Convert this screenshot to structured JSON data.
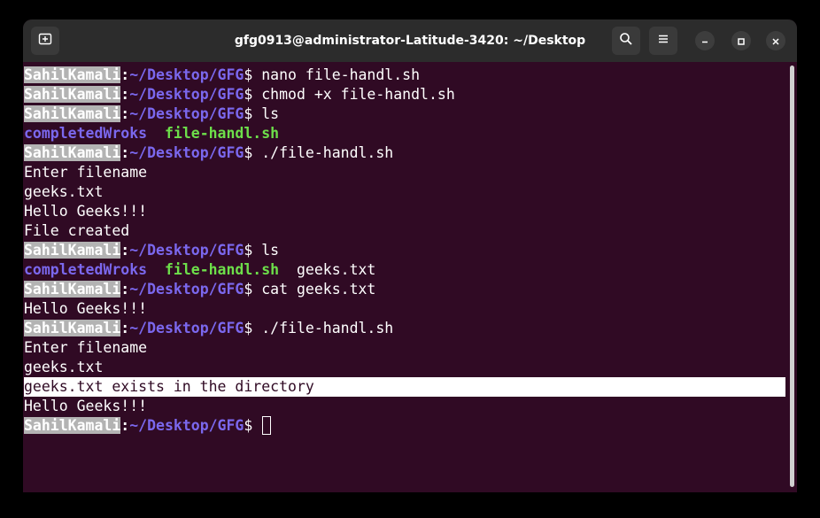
{
  "window": {
    "title": "gfg0913@administrator-Latitude-3420: ~/Desktop"
  },
  "icons": {
    "new_tab": "new-tab-icon",
    "search": "search-icon",
    "menu": "hamburger-menu-icon",
    "minimize": "minimize-icon",
    "maximize": "maximize-icon",
    "close": "close-icon"
  },
  "colors": {
    "terminal_bg": "#300a24",
    "prompt_user_bg": "#b3b3b3",
    "prompt_path": "#7b68ee",
    "exec_file": "#6ddf4a",
    "directory": "#7b68ee"
  },
  "prompt": {
    "user": "SahilKamali",
    "colon": ":",
    "path": "~/Desktop/GFG",
    "dollar": "$"
  },
  "lines": [
    {
      "type": "prompt",
      "cmd": " nano file-handl.sh"
    },
    {
      "type": "prompt",
      "cmd": " chmod +x file-handl.sh"
    },
    {
      "type": "prompt",
      "cmd": " ls"
    },
    {
      "type": "ls",
      "items": [
        "completedWroks",
        "  ",
        "file-handl.sh"
      ]
    },
    {
      "type": "prompt",
      "cmd": " ./file-handl.sh"
    },
    {
      "type": "text",
      "text": "Enter filename"
    },
    {
      "type": "text",
      "text": "geeks.txt"
    },
    {
      "type": "text",
      "text": "Hello Geeks!!!"
    },
    {
      "type": "text",
      "text": "File created"
    },
    {
      "type": "prompt",
      "cmd": " ls"
    },
    {
      "type": "ls",
      "items": [
        "completedWroks",
        "  ",
        "file-handl.sh",
        "  geeks.txt"
      ]
    },
    {
      "type": "prompt",
      "cmd": " cat geeks.txt"
    },
    {
      "type": "text",
      "text": "Hello Geeks!!!"
    },
    {
      "type": "prompt",
      "cmd": " ./file-handl.sh"
    },
    {
      "type": "text",
      "text": "Enter filename"
    },
    {
      "type": "text",
      "text": "geeks.txt"
    },
    {
      "type": "highlight",
      "text": "geeks.txt exists in the directory"
    },
    {
      "type": "text",
      "text": "Hello Geeks!!!"
    },
    {
      "type": "prompt",
      "cmd": " ",
      "cursor": true
    }
  ]
}
